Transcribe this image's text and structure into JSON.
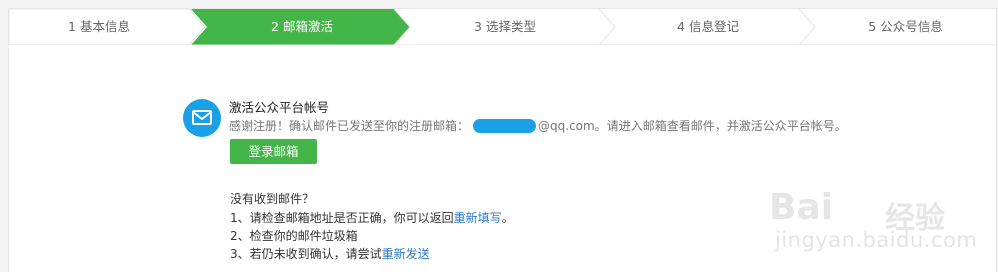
{
  "steps": [
    {
      "label": "1 基本信息",
      "active": false
    },
    {
      "label": "2 邮箱激活",
      "active": true
    },
    {
      "label": "3 选择类型",
      "active": false
    },
    {
      "label": "4 信息登记",
      "active": false
    },
    {
      "label": "5 公众号信息",
      "active": false
    }
  ],
  "activation": {
    "title": "激活公众平台帐号",
    "message_prefix": "感谢注册！确认邮件已发送至你的注册邮箱：",
    "message_domain": "@qq.com",
    "message_suffix": "。请进入邮箱查看邮件，并激活公众平台帐号。",
    "login_button": "登录邮箱"
  },
  "help": {
    "title": "没有收到邮件？",
    "item1_text": "1、请检查邮箱地址是否正确，你可以返回",
    "item1_link": "重新填写",
    "item1_end": "。",
    "item2_text": "2、检查你的邮件垃圾箱",
    "item3_text": "3、若仍未收到确认，请尝试",
    "item3_link": "重新发送"
  },
  "watermark": {
    "brand": "Bai",
    "brand_cn": "经验",
    "url": "jingyan.baidu.com"
  },
  "colors": {
    "active_step": "#44b549",
    "button": "#44b549",
    "icon": "#1aa0e6",
    "link": "#2a79c8"
  }
}
